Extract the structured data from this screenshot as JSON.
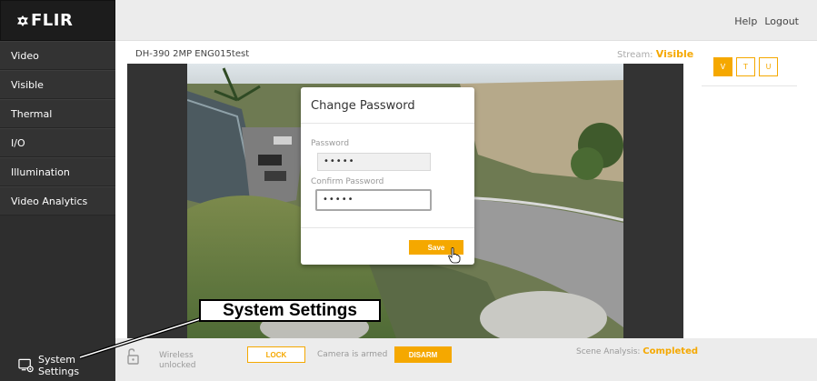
{
  "brand": {
    "logo_text": "FLIR"
  },
  "sidebar": {
    "items": [
      {
        "label": "Video"
      },
      {
        "label": "Visible"
      },
      {
        "label": "Thermal"
      },
      {
        "label": "I/O"
      },
      {
        "label": "Illumination"
      },
      {
        "label": "Video Analytics"
      }
    ],
    "system_settings_label": "System Settings"
  },
  "header": {
    "help_label": "Help",
    "logout_label": "Logout"
  },
  "stream": {
    "camera_name": "DH-390 2MP ENG015test",
    "stream_label": "Stream:",
    "stream_value": "Visible"
  },
  "dialog": {
    "title": "Change Password",
    "password_label": "Password",
    "password_value": "•••••",
    "confirm_label": "Confirm Password",
    "confirm_value": "•••••",
    "save_label": "Save"
  },
  "view_modes": {
    "v": "V",
    "t": "T",
    "u": "U",
    "active": "V"
  },
  "bottom": {
    "wireless_line1": "Wireless",
    "wireless_line2": "unlocked",
    "lock_label": "LOCK",
    "armed_text": "Camera is armed",
    "disarm_label": "DISARM",
    "scene_label": "Scene Analysis:",
    "scene_value": "Completed"
  },
  "callout": {
    "text": "System Settings"
  },
  "colors": {
    "accent": "#f5a800",
    "sidebar_bg": "#2e2e2e",
    "header_bg": "#ececec",
    "viewport_bg": "#333333"
  },
  "icons": {
    "logo": "flir-logo-icon",
    "system_settings": "monitor-gear-icon",
    "lock": "padlock-open-icon",
    "cursor": "hand-pointer-icon"
  }
}
